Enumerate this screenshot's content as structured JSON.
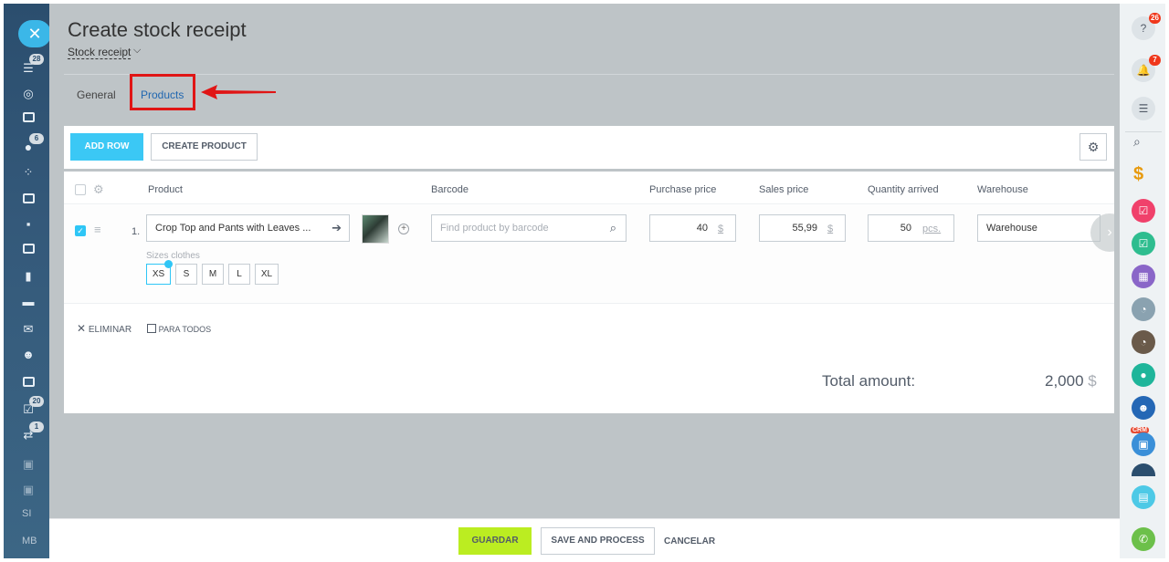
{
  "page": {
    "title": "Create stock receipt",
    "subtitle": "Stock receipt"
  },
  "tabs": [
    {
      "label": "General"
    },
    {
      "label": "Products"
    }
  ],
  "toolbar": {
    "add_row": "ADD ROW",
    "create_product": "CREATE PRODUCT"
  },
  "columns": {
    "product": "Product",
    "barcode": "Barcode",
    "purchase_price": "Purchase price",
    "sales_price": "Sales price",
    "quantity_arrived": "Quantity arrived",
    "warehouse": "Warehouse"
  },
  "row": {
    "number": "1.",
    "product_name": "Crop Top and Pants with Leaves ...",
    "barcode_placeholder": "Find product by barcode",
    "purchase_price": "40",
    "purchase_currency": "$",
    "sales_price": "55,99",
    "sales_currency": "$",
    "quantity": "50",
    "quantity_unit": "pcs.",
    "warehouse": "Warehouse",
    "sizes_label": "Sizes clothes",
    "sizes": [
      "XS",
      "S",
      "M",
      "L",
      "XL"
    ],
    "selected_size": "XS"
  },
  "actions": {
    "delete": "ELIMINAR",
    "for_all": "PARA TODOS"
  },
  "total": {
    "label": "Total amount:",
    "value": "2,000",
    "currency": "$"
  },
  "footer": {
    "save": "GUARDAR",
    "save_process": "SAVE AND PROCESS",
    "cancel": "CANCELAR"
  },
  "left_sidebar": {
    "badges": [
      "28",
      "6",
      "20",
      "1"
    ],
    "initials": [
      "SI",
      "MB"
    ]
  },
  "right_sidebar": {
    "help_badge": "26",
    "notifications_badge": "7",
    "crm_label": "CRM"
  },
  "colors": {
    "accent": "#3bc8f5",
    "save": "#bbed21",
    "highlight": "#e01515",
    "link": "#2067b0"
  }
}
